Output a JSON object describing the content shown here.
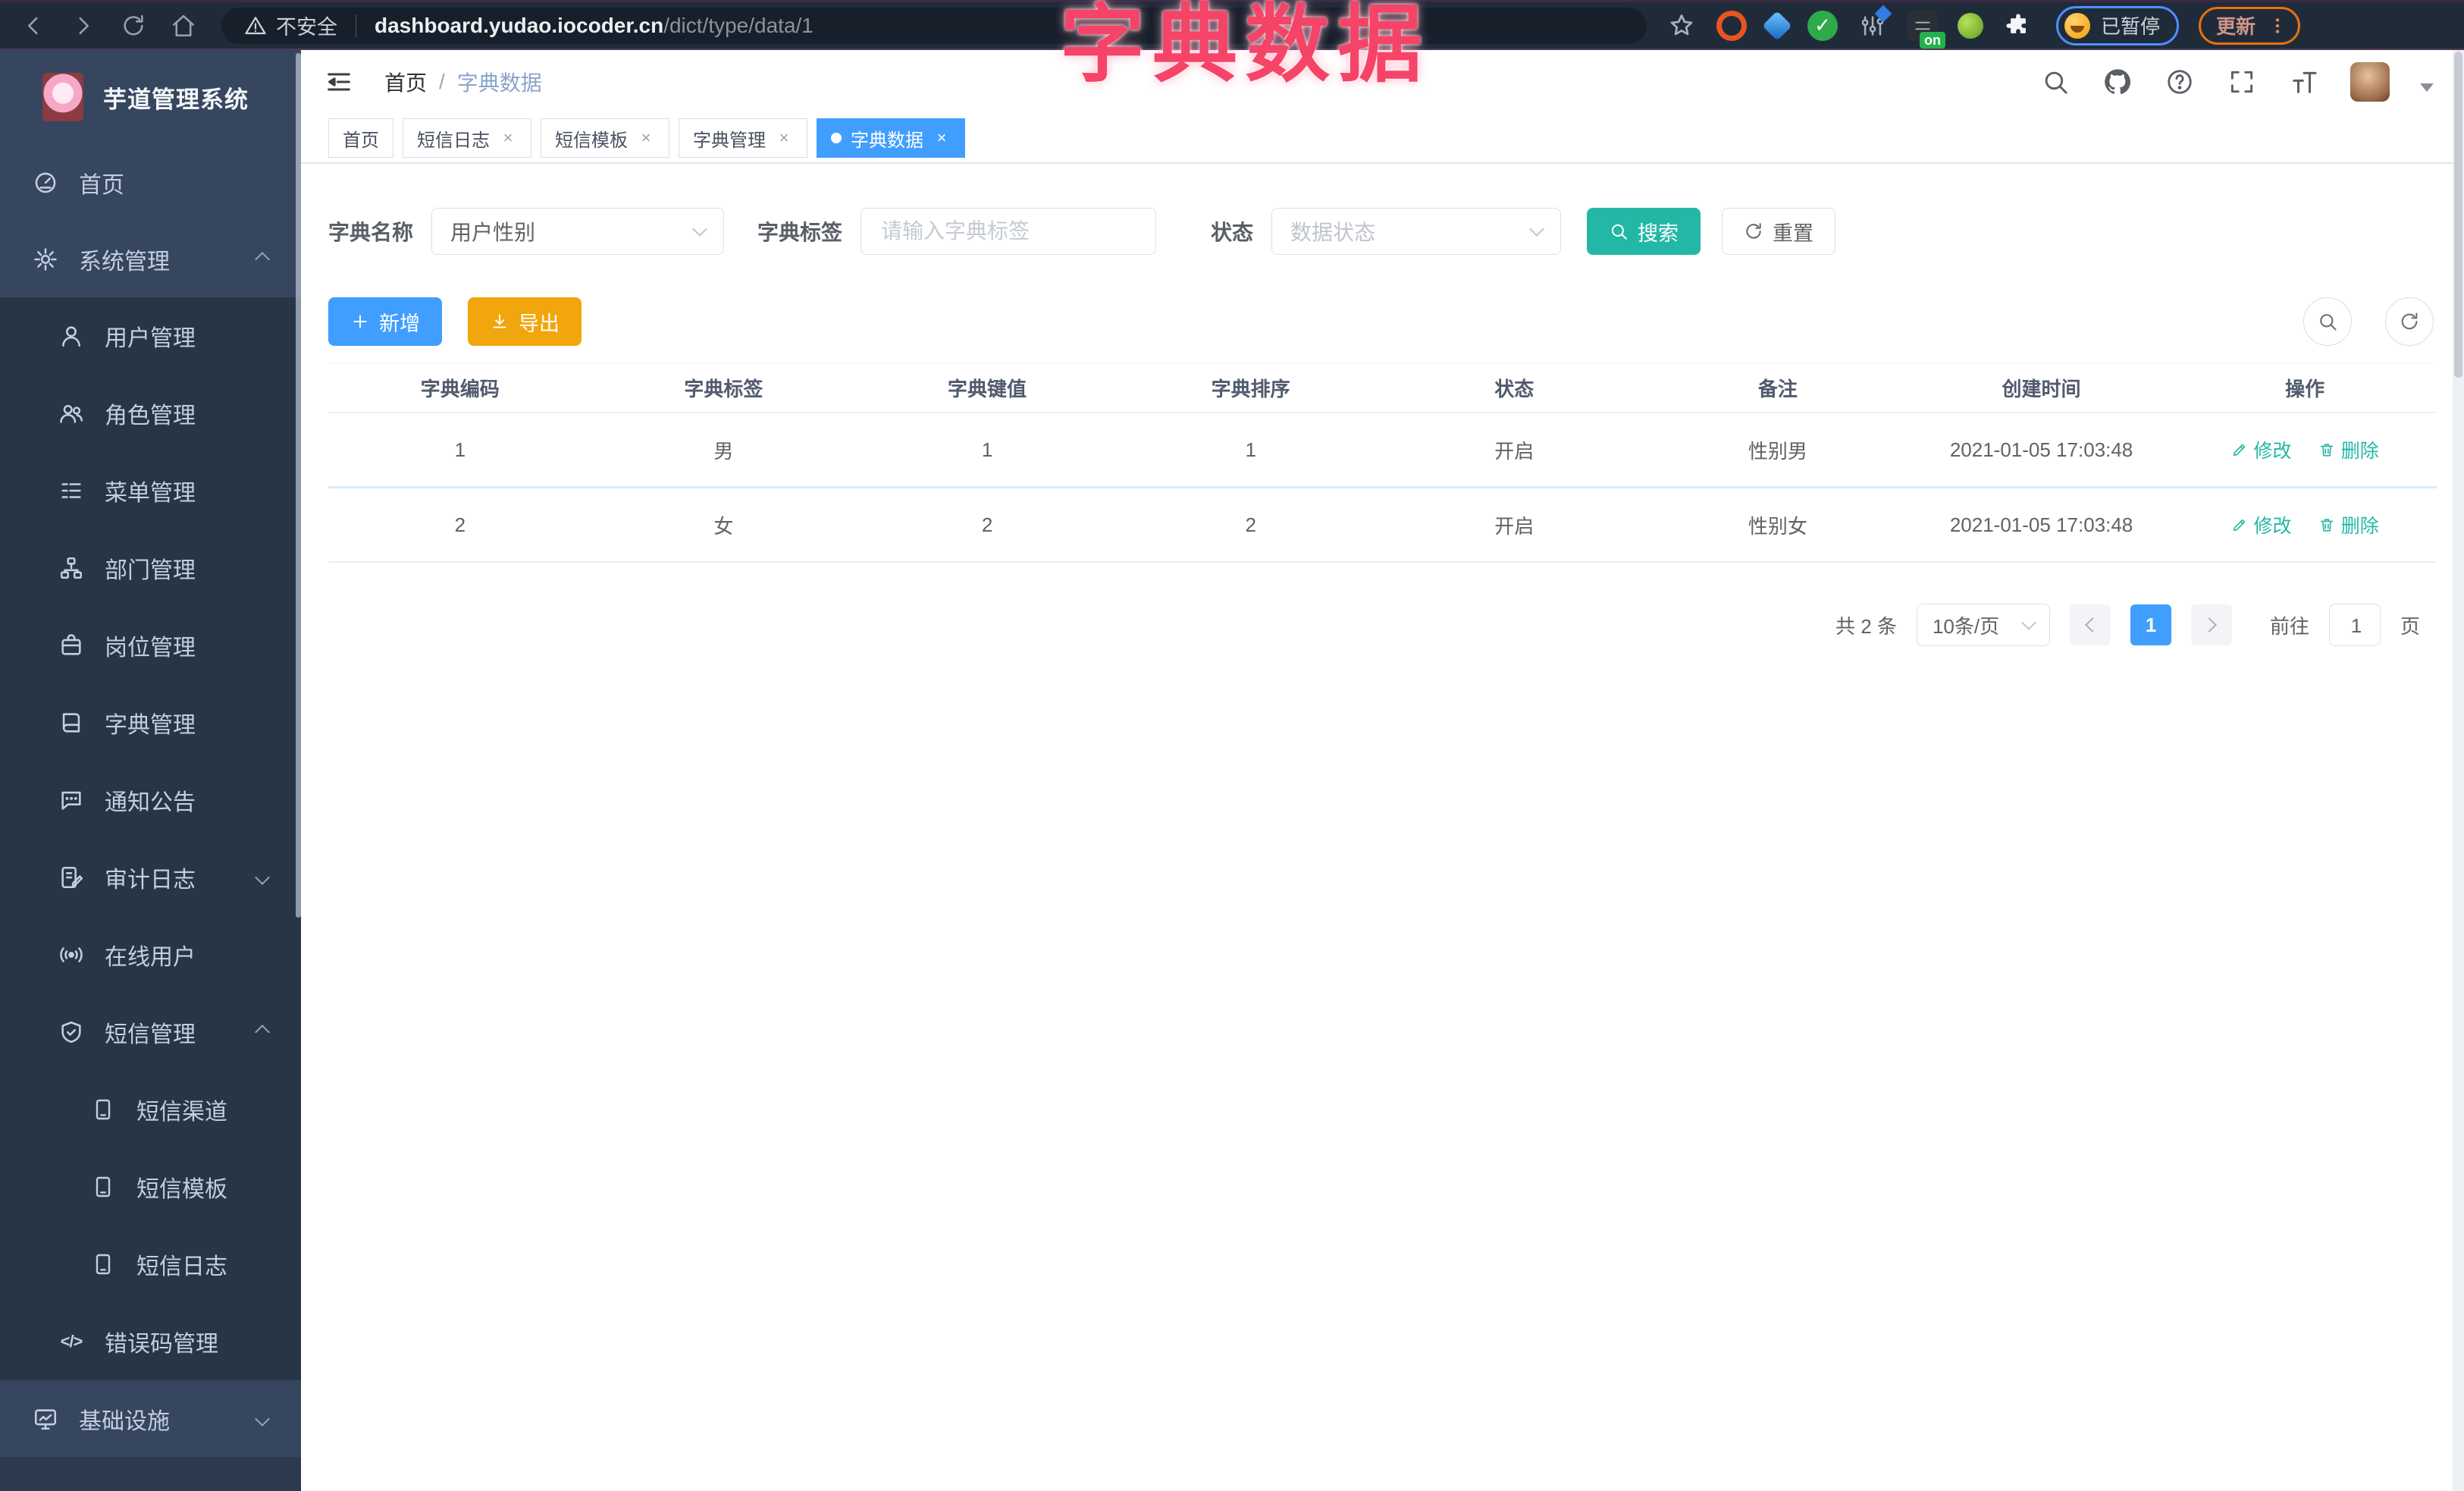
{
  "browser": {
    "security_label": "不安全",
    "url_host": "dashboard.yudao.iocoder.cn",
    "url_path": "/dict/type/data/1",
    "on_badge": "on",
    "paused_badge": "已暂停",
    "update_button": "更新"
  },
  "overlay_title": "字典数据",
  "sidebar": {
    "app_title": "芋道管理系统",
    "items": [
      {
        "label": "首页",
        "icon": "dashboard-icon"
      },
      {
        "label": "系统管理",
        "icon": "gear-icon",
        "chevron": "up"
      },
      {
        "label": "用户管理",
        "icon": "user-icon"
      },
      {
        "label": "角色管理",
        "icon": "users-icon"
      },
      {
        "label": "菜单管理",
        "icon": "menu-list-icon"
      },
      {
        "label": "部门管理",
        "icon": "org-tree-icon"
      },
      {
        "label": "岗位管理",
        "icon": "badge-icon"
      },
      {
        "label": "字典管理",
        "icon": "book-icon"
      },
      {
        "label": "通知公告",
        "icon": "chat-icon"
      },
      {
        "label": "审计日志",
        "icon": "audit-log-icon",
        "chevron": "down"
      },
      {
        "label": "在线用户",
        "icon": "online-users-icon"
      },
      {
        "label": "短信管理",
        "icon": "shield-icon",
        "chevron": "up"
      },
      {
        "label": "短信渠道",
        "icon": "phone-icon"
      },
      {
        "label": "短信模板",
        "icon": "phone-icon"
      },
      {
        "label": "短信日志",
        "icon": "phone-icon"
      },
      {
        "label": "错误码管理",
        "icon": "code-icon",
        "code_glyph": "</>"
      },
      {
        "label": "基础设施",
        "icon": "monitor-icon",
        "chevron": "down"
      }
    ]
  },
  "header": {
    "breadcrumb": {
      "home": "首页",
      "separator": "/",
      "current": "字典数据"
    }
  },
  "tabs_meta": {
    "close_glyph": "×"
  },
  "tabs": [
    {
      "label": "首页",
      "closable": false
    },
    {
      "label": "短信日志",
      "closable": true
    },
    {
      "label": "短信模板",
      "closable": true
    },
    {
      "label": "字典管理",
      "closable": true
    },
    {
      "label": "字典数据",
      "closable": true,
      "active": true
    }
  ],
  "filters": {
    "dict_name_label": "字典名称",
    "dict_name_value": "用户性别",
    "dict_label_label": "字典标签",
    "dict_label_placeholder": "请输入字典标签",
    "status_label": "状态",
    "status_placeholder": "数据状态",
    "search_button": "搜索",
    "reset_button": "重置"
  },
  "toolbar": {
    "add_label": "新增",
    "export_label": "导出"
  },
  "table": {
    "headers": [
      "字典编码",
      "字典标签",
      "字典键值",
      "字典排序",
      "状态",
      "备注",
      "创建时间",
      "操作"
    ],
    "rows": [
      {
        "code": "1",
        "label": "男",
        "value": "1",
        "sort": "1",
        "status": "开启",
        "remark": "性别男",
        "created": "2021-01-05 17:03:48"
      },
      {
        "code": "2",
        "label": "女",
        "value": "2",
        "sort": "2",
        "status": "开启",
        "remark": "性别女",
        "created": "2021-01-05 17:03:48"
      }
    ],
    "actions": {
      "edit": "修改",
      "delete": "删除"
    }
  },
  "pagination": {
    "total": "共 2 条",
    "page_size": "10条/页",
    "current_page": "1",
    "goto_label": "前往",
    "goto_value": "1",
    "page_suffix": "页"
  },
  "colors": {
    "primary_blue": "#409eff",
    "teal": "#23b8a6",
    "warning_orange": "#f2a60d",
    "pink_title": "#f54468",
    "sidebar_bg": "#37465f",
    "submenu_bg": "#273546"
  }
}
